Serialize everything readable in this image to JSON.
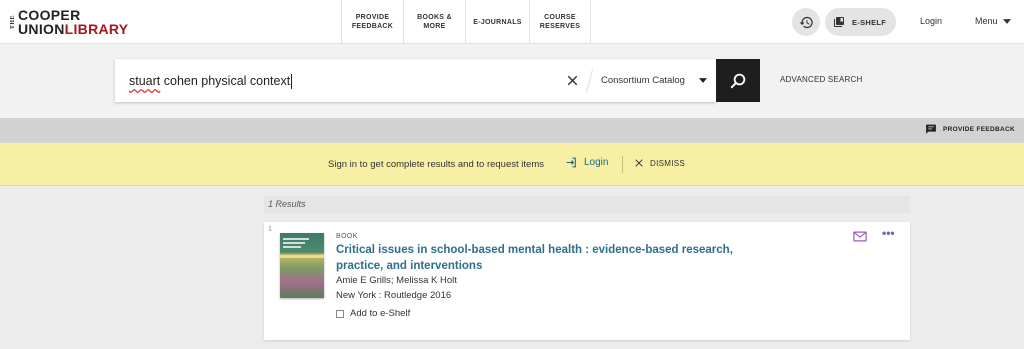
{
  "header": {
    "logo": {
      "the": "THE",
      "line1": "COOPER",
      "line2_a": "UNION",
      "line2_b": "LIBRARY"
    },
    "nav": [
      {
        "label": "PROVIDE\nFEEDBACK"
      },
      {
        "label": "BOOKS &\nMORE"
      },
      {
        "label": "E-JOURNALS"
      },
      {
        "label": "COURSE\nRESERVES"
      }
    ],
    "eshelf_label": "E-SHELF",
    "login_label": "Login",
    "menu_label": "Menu"
  },
  "search": {
    "query_word1": "stuart",
    "query_rest": " cohen physical context",
    "scope": "Consortium Catalog",
    "advanced_label": "ADVANCED SEARCH"
  },
  "feedback": {
    "label": "PROVIDE FEEDBACK"
  },
  "signin_banner": {
    "text": "Sign in to get complete results and to request items",
    "login_label": "Login",
    "dismiss_label": "DISMISS"
  },
  "results": {
    "count_text": "1 Results",
    "items": [
      {
        "number": "1",
        "type": "BOOK",
        "title": "Critical issues in school-based mental health : evidence-based research, practice, and interventions",
        "authors": "Amie E Grills; Melissa K Holt",
        "publication": "New York : Routledge 2016",
        "add_to_eshelf": "Add to e-Shelf"
      }
    ]
  },
  "colors": {
    "brand_red": "#a3181c",
    "link_blue": "#2f6e8c",
    "banner_yellow": "#f7efa3",
    "accent_purple": "#7a5fa3"
  }
}
